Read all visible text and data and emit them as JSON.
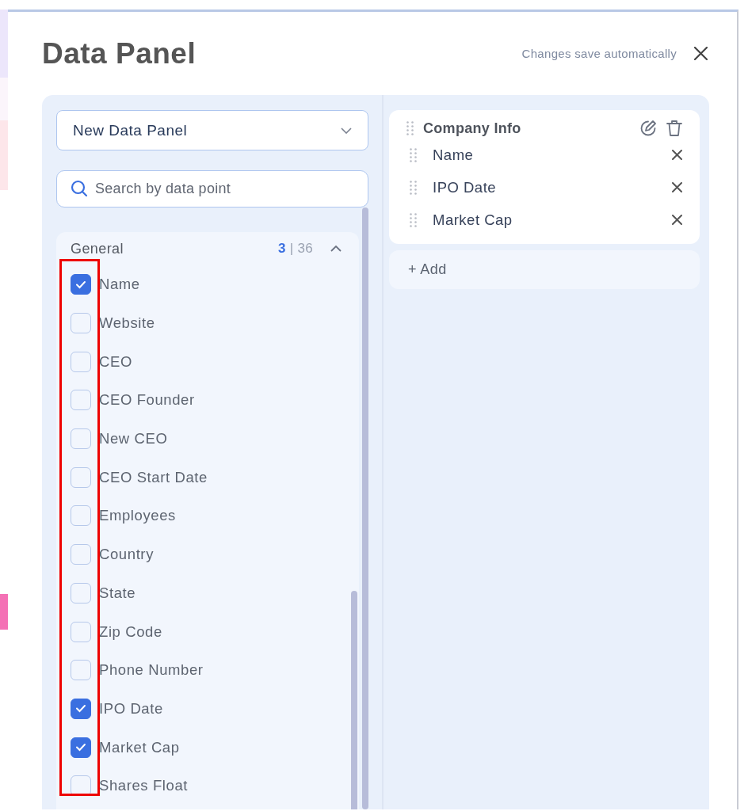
{
  "dialog": {
    "title": "Data Panel",
    "autosave_note": "Changes save automatically"
  },
  "panel_select": {
    "value": "New Data Panel"
  },
  "search": {
    "placeholder": "Search by data point"
  },
  "category": {
    "name": "General",
    "selected_count": "3",
    "separator": "|",
    "total_count": "36",
    "expanded": true,
    "items": [
      {
        "label": "Name",
        "checked": true
      },
      {
        "label": "Website",
        "checked": false
      },
      {
        "label": "CEO",
        "checked": false
      },
      {
        "label": "CEO Founder",
        "checked": false
      },
      {
        "label": "New CEO",
        "checked": false
      },
      {
        "label": "CEO Start Date",
        "checked": false
      },
      {
        "label": "Employees",
        "checked": false
      },
      {
        "label": "Country",
        "checked": false
      },
      {
        "label": "State",
        "checked": false
      },
      {
        "label": "Zip Code",
        "checked": false
      },
      {
        "label": "Phone Number",
        "checked": false
      },
      {
        "label": "IPO Date",
        "checked": true
      },
      {
        "label": "Market Cap",
        "checked": true
      },
      {
        "label": "Shares Float",
        "checked": false
      }
    ]
  },
  "group": {
    "name": "Company Info",
    "fields": [
      {
        "label": "Name"
      },
      {
        "label": "IPO Date"
      },
      {
        "label": "Market Cap"
      }
    ]
  },
  "add_button": "+ Add"
}
